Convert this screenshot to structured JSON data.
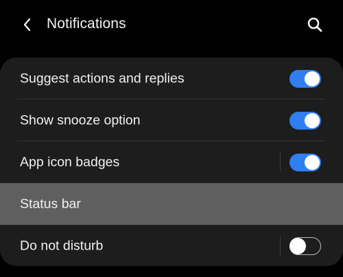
{
  "header": {
    "title": "Notifications",
    "back_icon": "chevron-left-icon",
    "search_icon": "search-icon"
  },
  "colors": {
    "toggle_on": "#2f7ff0",
    "highlight_row": "#5f5f5f",
    "card_bg": "#1d1d1d"
  },
  "settings": {
    "items": [
      {
        "label": "Suggest actions and replies",
        "toggle": "on"
      },
      {
        "label": "Show snooze option",
        "toggle": "on"
      },
      {
        "label": "App icon badges",
        "toggle": "on"
      },
      {
        "label": "Status bar",
        "toggle": null
      },
      {
        "label": "Do not disturb",
        "toggle": "off"
      }
    ]
  }
}
